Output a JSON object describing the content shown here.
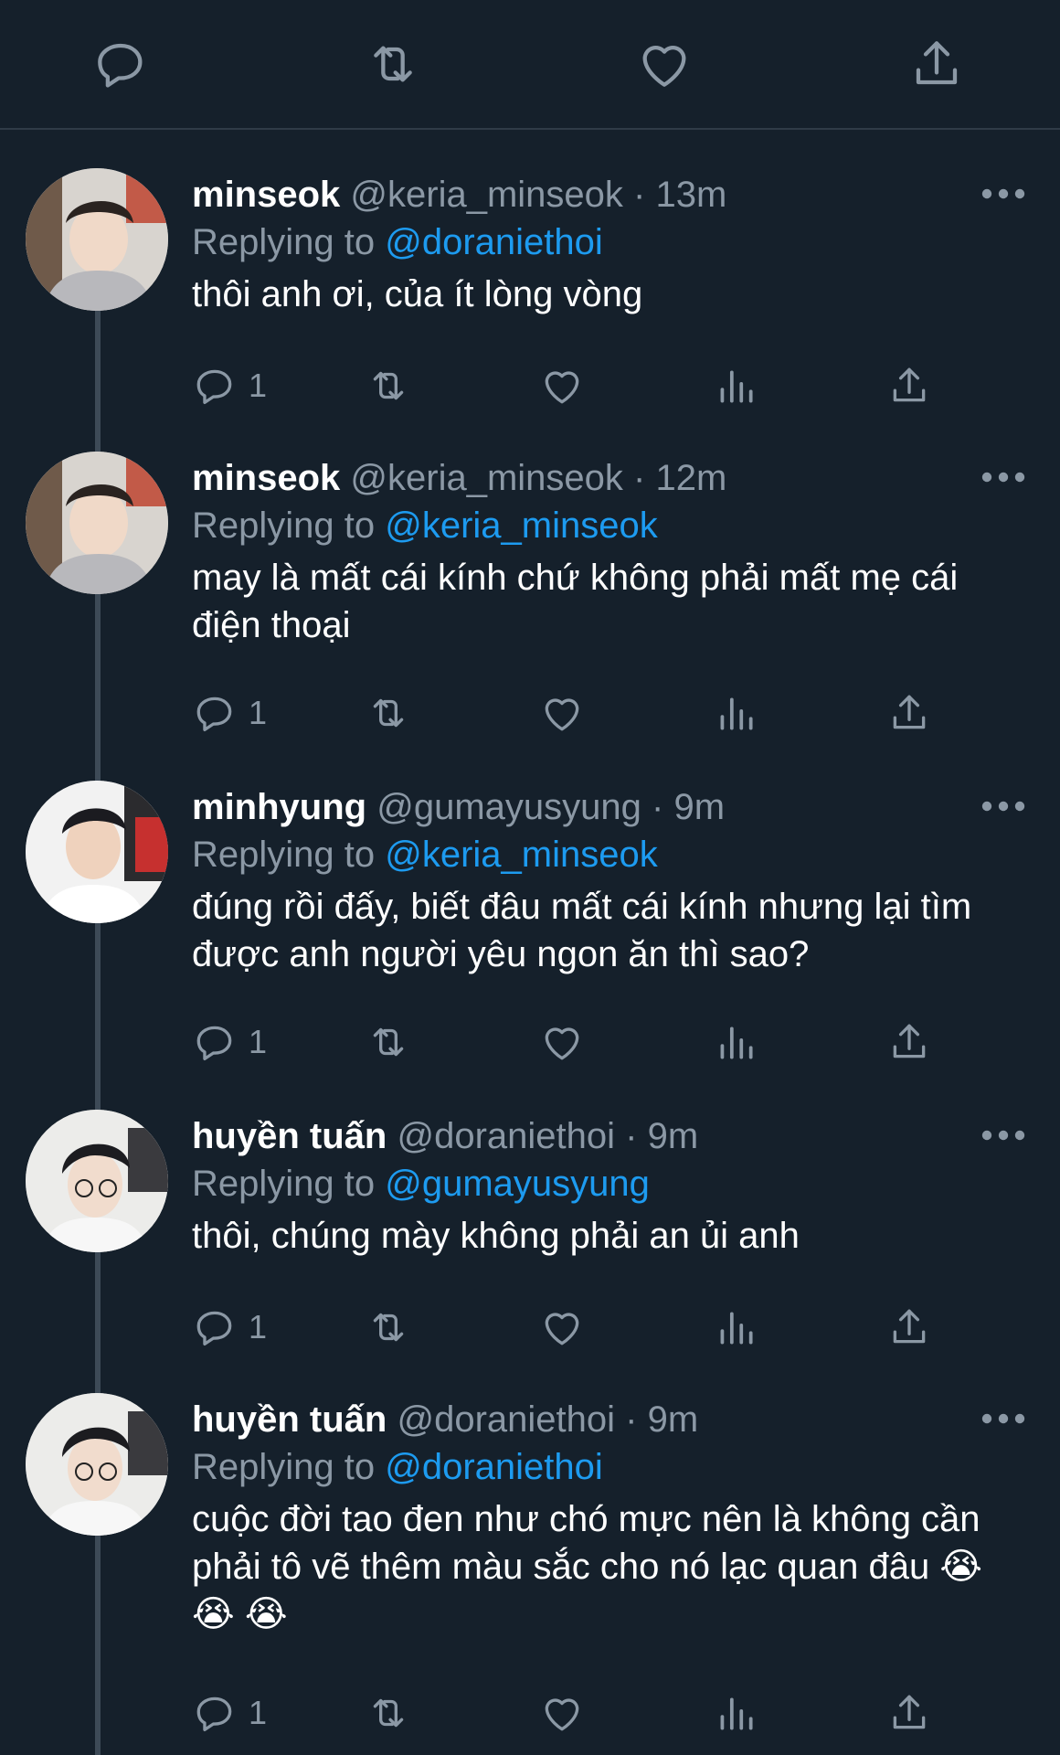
{
  "top_actions": [
    {
      "icon": "reply-icon"
    },
    {
      "icon": "retweet-icon"
    },
    {
      "icon": "like-icon"
    },
    {
      "icon": "share-icon"
    }
  ],
  "replies": [
    {
      "display_name": "minseok",
      "handle": "@keria_minseok",
      "separator": "·",
      "time": "13m",
      "replying_label": "Replying to",
      "replying_to": "@doraniethoi",
      "text": "thôi anh ơi, của ít lòng vòng",
      "reply_count": "1"
    },
    {
      "display_name": "minseok",
      "handle": "@keria_minseok",
      "separator": "·",
      "time": "12m",
      "replying_label": "Replying to",
      "replying_to": "@keria_minseok",
      "text": "may là mất cái kính chứ không phải mất mẹ cái điện thoại",
      "reply_count": "1"
    },
    {
      "display_name": "minhyung",
      "handle": "@gumayusyung",
      "separator": "·",
      "time": "9m",
      "replying_label": "Replying to",
      "replying_to": "@keria_minseok",
      "text": "đúng rồi đấy, biết đâu mất cái kính nhưng lại tìm được anh người yêu ngon ăn thì sao?",
      "reply_count": "1"
    },
    {
      "display_name": "huyền tuấn",
      "handle": "@doraniethoi",
      "separator": "·",
      "time": "9m",
      "replying_label": "Replying to",
      "replying_to": "@gumayusyung",
      "text": "thôi, chúng mày không phải an ủi anh",
      "reply_count": "1"
    },
    {
      "display_name": "huyền tuấn",
      "handle": "@doraniethoi",
      "separator": "·",
      "time": "9m",
      "replying_label": "Replying to",
      "replying_to": "@doraniethoi",
      "text": "cuộc đời tao đen như chó mực nên là không cần phải tô vẽ thêm màu sắc cho nó lạc quan đâu 😭 😭 😭",
      "reply_count": "1"
    }
  ],
  "colors": {
    "background": "#15202b",
    "text": "#ffffff",
    "muted": "#8b98a5",
    "link": "#1d9bf0",
    "divider": "#2f3b47"
  }
}
